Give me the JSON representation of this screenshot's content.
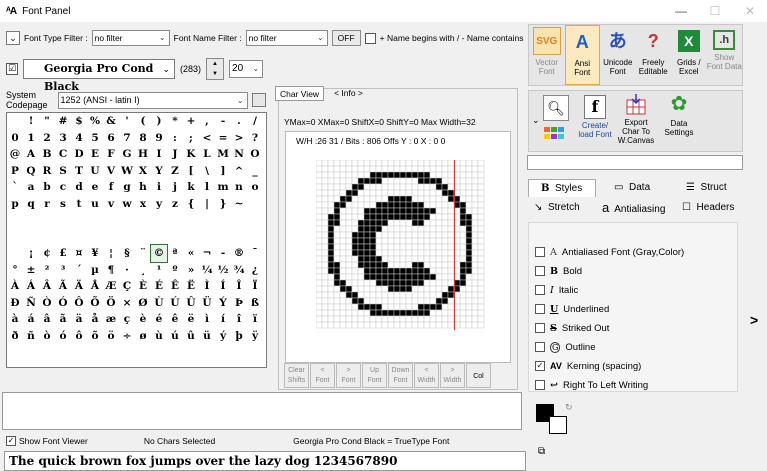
{
  "window": {
    "app_icon": "ᴬA",
    "title": "Font Panel",
    "min": "—",
    "max": "☐",
    "close": "✕"
  },
  "filterbar": {
    "font_type_label": "Font Type Filter :",
    "font_type_value": "no filter",
    "font_name_label": "Font Name Filter :",
    "font_name_value": "no filter",
    "off_button": "OFF",
    "name_begins_label": "+ Name begins with / - Name contains"
  },
  "fontselect": {
    "checkbox": "☑",
    "font_name": "Georgia Pro Cond Black",
    "count": "(283)",
    "size": "20",
    "spin_up": "▲",
    "spin_down": "▼"
  },
  "codepage": {
    "label_line1": "System",
    "label_line2": "Codepage",
    "value": "1252  (ANSI - latin I)"
  },
  "charmap": {
    "rows": [
      [
        " ",
        "!",
        "\"",
        "#",
        "$",
        "%",
        "&",
        "'",
        "(",
        ")",
        "*",
        "+",
        ",",
        "-",
        ".",
        "/"
      ],
      [
        "0",
        "1",
        "2",
        "3",
        "4",
        "5",
        "6",
        "7",
        "8",
        "9",
        ":",
        ";",
        "<",
        "=",
        ">",
        "?"
      ],
      [
        "@",
        "A",
        "B",
        "C",
        "D",
        "E",
        "F",
        "G",
        "H",
        "I",
        "J",
        "K",
        "L",
        "M",
        "N",
        "O"
      ],
      [
        "P",
        "Q",
        "R",
        "S",
        "T",
        "U",
        "V",
        "W",
        "X",
        "Y",
        "Z",
        "[",
        "\\",
        "]",
        "^",
        "_"
      ],
      [
        "`",
        "a",
        "b",
        "c",
        "d",
        "e",
        "f",
        "g",
        "h",
        "i",
        "j",
        "k",
        "l",
        "m",
        "n",
        "o"
      ],
      [
        "p",
        "q",
        "r",
        "s",
        "t",
        "u",
        "v",
        "w",
        "x",
        "y",
        "z",
        "{",
        "|",
        "}",
        "~",
        ""
      ],
      [
        "",
        "",
        "",
        "",
        "",
        "",
        "",
        "",
        "",
        "",
        "",
        "",
        "",
        "",
        "",
        ""
      ],
      [
        "",
        "",
        "",
        "",
        "",
        "",
        "",
        "",
        "",
        "",
        "",
        "",
        "",
        "",
        "",
        ""
      ],
      [
        " ",
        "¡",
        "¢",
        "£",
        "¤",
        "¥",
        "¦",
        "§",
        "¨",
        "©",
        "ª",
        "«",
        "¬",
        "-",
        "®",
        "¯"
      ],
      [
        "°",
        "±",
        "²",
        "³",
        "´",
        "µ",
        "¶",
        "·",
        "¸",
        "¹",
        "º",
        "»",
        "¼",
        "½",
        "¾",
        "¿"
      ],
      [
        "À",
        "Á",
        "Â",
        "Ã",
        "Ä",
        "Å",
        "Æ",
        "Ç",
        "È",
        "É",
        "Ê",
        "Ë",
        "Ì",
        "Í",
        "Î",
        "Ï"
      ],
      [
        "Ð",
        "Ñ",
        "Ò",
        "Ó",
        "Ô",
        "Õ",
        "Ö",
        "×",
        "Ø",
        "Ù",
        "Ú",
        "Û",
        "Ü",
        "Ý",
        "Þ",
        "ß"
      ],
      [
        "à",
        "á",
        "â",
        "ã",
        "ä",
        "å",
        "æ",
        "ç",
        "è",
        "é",
        "ê",
        "ë",
        "ì",
        "í",
        "î",
        "ï"
      ],
      [
        "ð",
        "ñ",
        "ò",
        "ó",
        "ô",
        "õ",
        "ö",
        "÷",
        "ø",
        "ù",
        "ú",
        "û",
        "ü",
        "ý",
        "þ",
        "ÿ"
      ]
    ],
    "selected_char": "©"
  },
  "charview": {
    "tab_charview": "Char View",
    "tab_info": "< Info >",
    "metrics": "YMax=0  XMax=0  ShiftX=0  ShiftY=0  Max Width=32",
    "wh": "W/H :26  31 / Bits : 806  Offs Y : 0  X : 0 0",
    "buttons": [
      {
        "l1": "Clear",
        "l2": "Shifts"
      },
      {
        "l1": "<",
        "l2": "Font"
      },
      {
        "l1": ">",
        "l2": "Font"
      },
      {
        "l1": "Up",
        "l2": "Font"
      },
      {
        "l1": "Down",
        "l2": "Font"
      },
      {
        "l1": "<",
        "l2": "Width"
      },
      {
        "l1": ">",
        "l2": "Width"
      },
      {
        "l1": "Col",
        "l2": ""
      }
    ]
  },
  "status": {
    "show_viewer": "Show Font Viewer",
    "chars_selected": "No Chars Selected",
    "font_info": "Georgia Pro Cond Black = TrueType Font"
  },
  "sample_text": "The quick brown fox jumps over the lazy dog 1234567890",
  "toolbar1": [
    {
      "icon": "SVG",
      "l1": "Vector",
      "l2": "Font",
      "active": false,
      "dim": true
    },
    {
      "icon": "A",
      "l1": "Ansi",
      "l2": "Font",
      "active": true,
      "dim": false
    },
    {
      "icon": "あ",
      "l1": "Unicode",
      "l2": "Font",
      "active": false,
      "dim": false
    },
    {
      "icon": "?",
      "l1": "Freely",
      "l2": "Editable",
      "active": false,
      "dim": false
    },
    {
      "icon": "X",
      "l1": "Grids /",
      "l2": "Excel",
      "active": false,
      "dim": false
    },
    {
      "icon": ".h",
      "l1": "Show",
      "l2": "Font Data",
      "active": false,
      "dim": true
    }
  ],
  "toolbar2": {
    "create": {
      "l1": "Create/",
      "l2": "load Font"
    },
    "export": {
      "l1": "Export",
      "l2": "Char To",
      "l3": "W.Canvas"
    },
    "settings": {
      "l1": "Data",
      "l2": "Settings"
    }
  },
  "tabs": {
    "styles": "Styles",
    "data": "Data",
    "struct": "Struct",
    "stretch": "Stretch",
    "antialiasing": "Antialiasing",
    "headers": "Headers"
  },
  "styles": [
    {
      "glyph": "A",
      "label": "Antialiased Font (Gray,Color)",
      "checked": false
    },
    {
      "glyph": "B",
      "label": "Bold",
      "checked": false
    },
    {
      "glyph": "I",
      "label": "Italic",
      "checked": false
    },
    {
      "glyph": "U",
      "label": "Underlined",
      "checked": false
    },
    {
      "glyph": "S",
      "label": "Striked Out",
      "checked": false
    },
    {
      "glyph": "G",
      "label": "Outline",
      "checked": false
    },
    {
      "glyph": "AV",
      "label": "Kerning (spacing)",
      "checked": true
    },
    {
      "glyph": "↩",
      "label": "Right To Left Writing",
      "checked": false
    }
  ],
  "side_arrow": ">"
}
